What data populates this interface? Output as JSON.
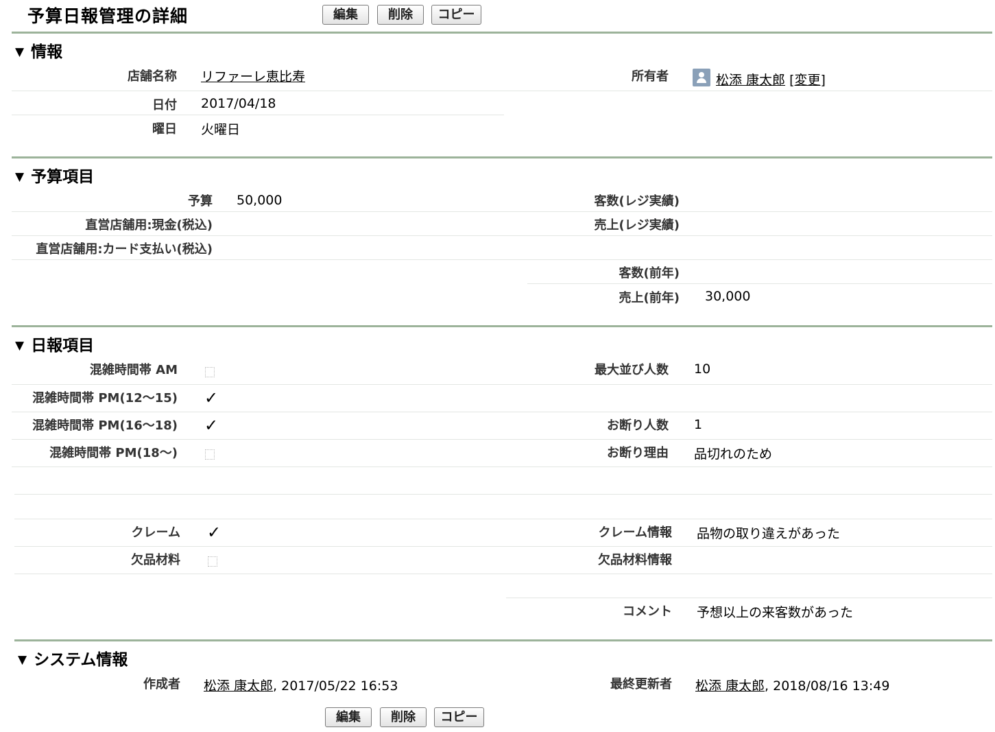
{
  "page": {
    "title": "予算日報管理の詳細"
  },
  "buttons": {
    "edit": "編集",
    "delete": "削除",
    "copy": "コピー"
  },
  "sections": {
    "info": "情報",
    "budget": "予算項目",
    "daily": "日報項目",
    "system": "システム情報"
  },
  "info": {
    "store_label": "店舗名称",
    "store_value": "リファーレ恵比寿",
    "owner_label": "所有者",
    "owner_value": "松添 康太郎",
    "owner_change": "[変更]",
    "date_label": "日付",
    "date_value": "2017/04/18",
    "weekday_label": "曜日",
    "weekday_value": "火曜日"
  },
  "budget": {
    "budget_label": "予算",
    "budget_value": "50,000",
    "cash_label": "直営店舗用:現金(税込)",
    "card_label": "直営店舗用:カード支払い(税込)",
    "reg_customers_label": "客数(レジ実績)",
    "reg_sales_label": "売上(レジ実績)",
    "prev_customers_label": "客数(前年)",
    "prev_sales_label": "売上(前年)",
    "prev_sales_value": "30,000"
  },
  "daily": {
    "am_label": "混雑時間帯 AM",
    "am_checked": false,
    "pm1_label": "混雑時間帯 PM(12〜15)",
    "pm1_checked": true,
    "pm2_label": "混雑時間帯 PM(16〜18)",
    "pm2_checked": true,
    "pm3_label": "混雑時間帯 PM(18〜)",
    "pm3_checked": false,
    "max_queue_label": "最大並び人数",
    "max_queue_value": "10",
    "refused_label": "お断り人数",
    "refused_value": "1",
    "refuse_reason_label": "お断り理由",
    "refuse_reason_value": "品切れのため",
    "claim_label": "クレーム",
    "claim_checked": true,
    "claim_info_label": "クレーム情報",
    "claim_info_value": "品物の取り違えがあった",
    "shortage_label": "欠品材料",
    "shortage_checked": false,
    "shortage_info_label": "欠品材料情報",
    "comment_label": "コメント",
    "comment_value": "予想以上の来客数があった",
    "check_glyph": "✓"
  },
  "system": {
    "created_label": "作成者",
    "created_user": "松添 康太郎",
    "created_time": ", 2017/05/22 16:53",
    "modified_label": "最終更新者",
    "modified_user": "松添 康太郎",
    "modified_time": ", 2018/08/16 13:49"
  },
  "colors": {
    "section_bar": "#9cb39a",
    "row_line": "#e3e6e3"
  }
}
